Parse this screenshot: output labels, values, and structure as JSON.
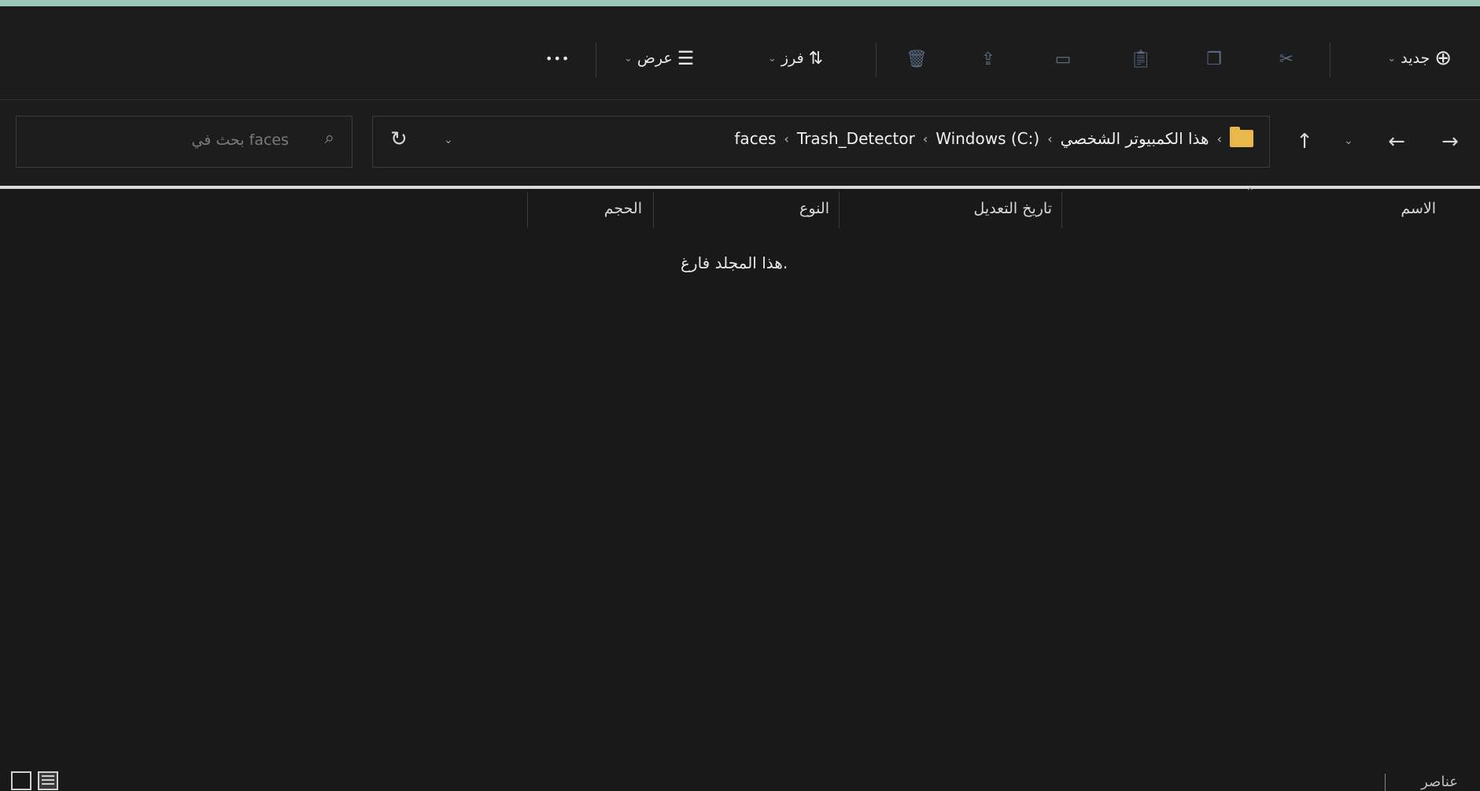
{
  "toolbar": {
    "new_label": "جديد",
    "sort_label": "فرز",
    "view_label": "عرض",
    "more_label": "•••"
  },
  "address": {
    "crumbs": [
      "هذا الكمبيوتر الشخصي",
      "Windows (C:)",
      "Trash_Detector",
      "faces"
    ],
    "search_placeholder": "بحث في faces"
  },
  "columns": {
    "name": "الاسم",
    "modified": "تاريخ التعديل",
    "type": "النوع",
    "size": "الحجم"
  },
  "empty_message": "هذا المجلد فارغ.",
  "status": {
    "items_text": "عناصر"
  },
  "colors": {
    "background": "#191919",
    "folder": "#e8b94a",
    "accent_strip": "#9cc7b9"
  }
}
